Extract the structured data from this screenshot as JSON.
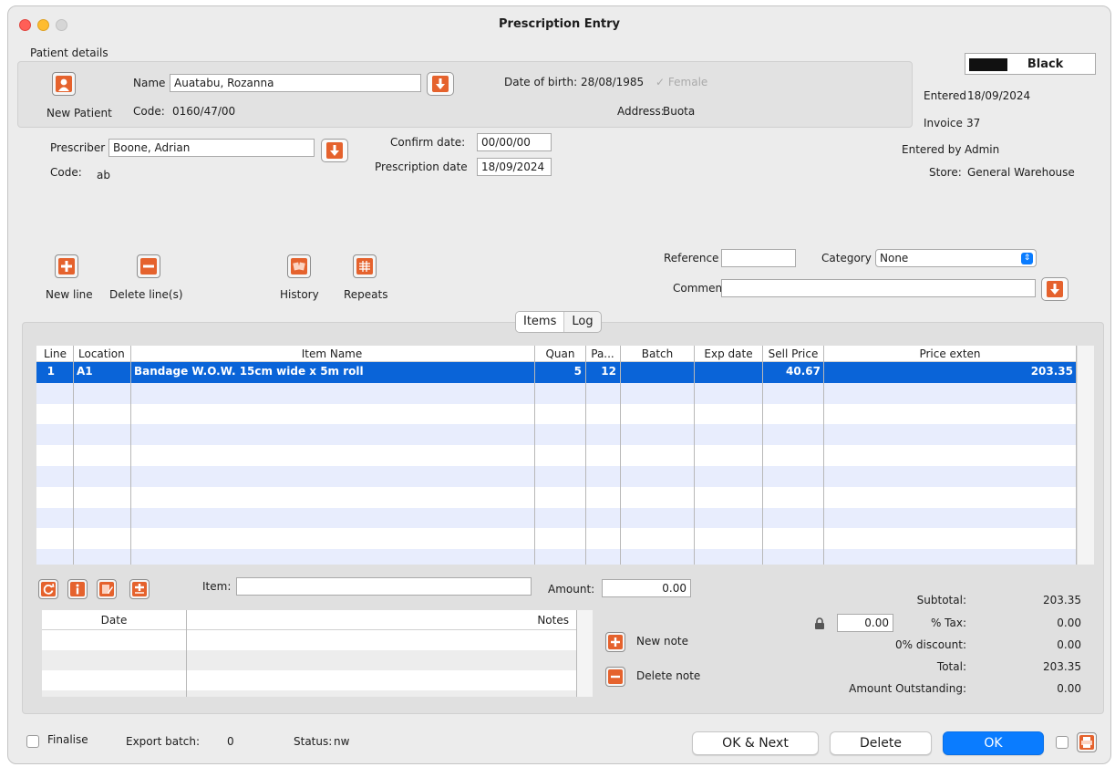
{
  "window": {
    "title": "Prescription Entry"
  },
  "patient": {
    "section_label": "Patient details",
    "new_patient_label": "New Patient",
    "name_label": "Name",
    "name_value": "Auatabu, Rozanna",
    "code_label": "Code:",
    "code_value": "0160/47/00",
    "dob_label": "Date of birth:",
    "dob_value": "28/08/1985",
    "gender_label": "Female",
    "address_label": "Address:",
    "address_value": "Buota"
  },
  "status_panel": {
    "color_name": "Black",
    "swatch_color": "#111111",
    "entered_label": "Entered",
    "entered_value": "18/09/2024",
    "invoice_label": "Invoice",
    "invoice_value": "37",
    "entered_by_label": "Entered by",
    "entered_by_value": "Admin",
    "store_label": "Store:",
    "store_value": "General Warehouse"
  },
  "prescriber": {
    "label": "Prescriber",
    "value": "Boone, Adrian",
    "code_label": "Code:",
    "code_value": "ab",
    "confirm_date_label": "Confirm date:",
    "confirm_date_value": "00/00/00",
    "prescription_date_label": "Prescription date",
    "prescription_date_value": "18/09/2024"
  },
  "toolbar": {
    "new_line": "New line",
    "delete_lines": "Delete line(s)",
    "history": "History",
    "repeats": "Repeats"
  },
  "meta": {
    "reference_label": "Reference",
    "reference_value": "",
    "category_label": "Category",
    "category_value": "None",
    "comment_label": "Comment",
    "comment_value": ""
  },
  "tabs": [
    {
      "label": "Items"
    },
    {
      "label": "Log"
    }
  ],
  "items_table": {
    "columns": [
      "Line",
      "Location",
      "Item Name",
      "Quan",
      "Pa...",
      "Batch",
      "Exp date",
      "Sell Price",
      "Price exten"
    ],
    "rows": [
      {
        "line": "1",
        "location": "A1",
        "item_name": "Bandage W.O.W. 15cm wide x 5m roll",
        "quantity": "5",
        "pack": "12",
        "batch": "",
        "exp_date": "",
        "sell_price": "40.67",
        "price_extension": "203.35"
      }
    ]
  },
  "item_entry": {
    "item_label": "Item:",
    "item_value": "",
    "amount_label": "Amount:",
    "amount_value": "0.00"
  },
  "notes_table": {
    "columns": [
      "Date",
      "Notes"
    ],
    "new_note": "New note",
    "delete_note": "Delete note"
  },
  "totals": {
    "subtotal_label": "Subtotal:",
    "subtotal_value": "203.35",
    "tax_rate_value": "0.00",
    "tax_label": "% Tax:",
    "tax_value": "0.00",
    "discount_label": "0% discount:",
    "discount_value": "0.00",
    "total_label": "Total:",
    "total_value": "203.35",
    "outstanding_label": "Amount Outstanding:",
    "outstanding_value": "0.00"
  },
  "footer": {
    "finalise_label": "Finalise",
    "export_batch_label": "Export batch:",
    "export_batch_value": "0",
    "status_label": "Status:",
    "status_value": "nw",
    "ok_next": "OK & Next",
    "delete": "Delete",
    "ok": "OK"
  },
  "colors": {
    "accent": "#0a7cff",
    "selection": "#0a64d8",
    "row_stripe": "#e8edfd",
    "icon_orange": "#e5622d"
  }
}
